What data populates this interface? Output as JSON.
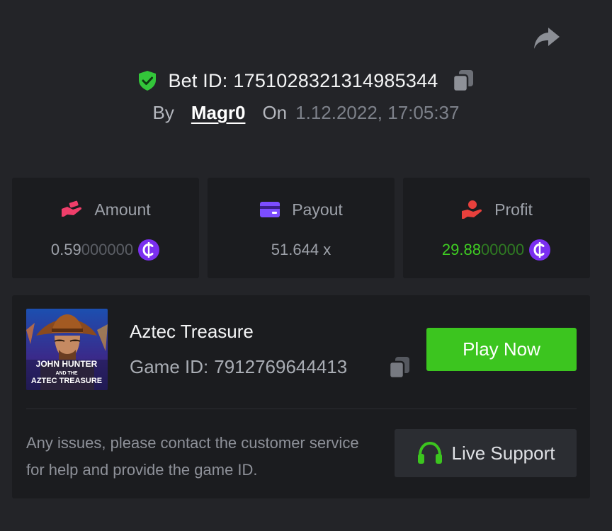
{
  "header": {
    "bet_id_label": "Bet ID:",
    "bet_id": "1751028321314985344",
    "by_label": "By",
    "username": "Magr0",
    "on_label": "On",
    "datetime": "1.12.2022, 17:05:37"
  },
  "stats": {
    "amount": {
      "label": "Amount",
      "value_main": "0.59",
      "value_dim": "000000",
      "icon": "amount-hand-icon"
    },
    "payout": {
      "label": "Payout",
      "value": "51.644 x",
      "icon": "card-icon"
    },
    "profit": {
      "label": "Profit",
      "value_main": "29.88",
      "value_dim": "00000",
      "icon": "profit-hand-icon"
    }
  },
  "game": {
    "name": "Aztec Treasure",
    "id_label": "Game ID:",
    "id": "7912769644413",
    "thumbnail_title": "JOHN HUNTER AND THE AZTEC TREASURE",
    "play_label": "Play Now"
  },
  "support": {
    "note": "Any issues, please contact the customer service for help and provide the game ID.",
    "button_label": "Live Support"
  },
  "colors": {
    "background": "#232428",
    "panel": "#1b1c1f",
    "green": "#3cc51f",
    "coin_purple": "#7b2ff0",
    "amount_pink": "#ef3e6a",
    "payout_purple": "#7c4dff",
    "profit_red": "#e8403c"
  }
}
